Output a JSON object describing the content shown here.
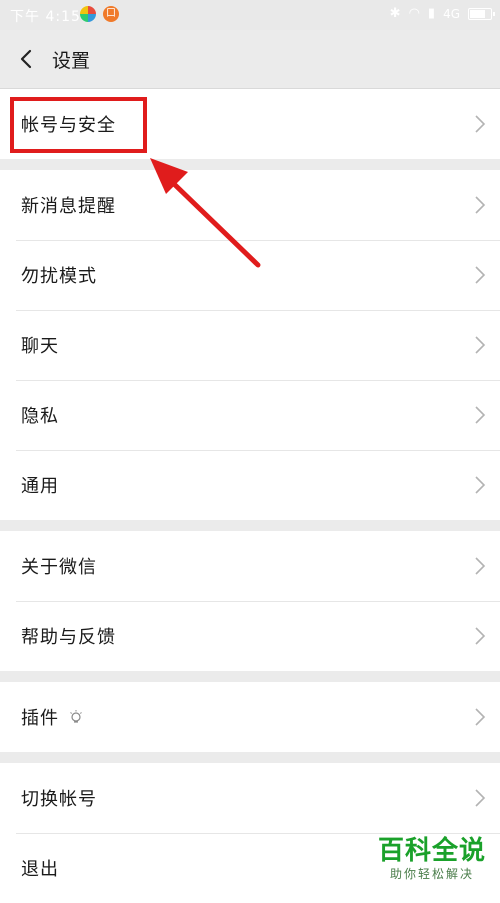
{
  "status_bar": {
    "time": "下午 4:15",
    "app2_glyph": "口",
    "network": "4G"
  },
  "header": {
    "title": "设置"
  },
  "groups": [
    {
      "items": [
        {
          "label": "帐号与安全"
        }
      ]
    },
    {
      "items": [
        {
          "label": "新消息提醒"
        },
        {
          "label": "勿扰模式"
        },
        {
          "label": "聊天"
        },
        {
          "label": "隐私"
        },
        {
          "label": "通用"
        }
      ]
    },
    {
      "items": [
        {
          "label": "关于微信"
        },
        {
          "label": "帮助与反馈"
        }
      ]
    },
    {
      "items": [
        {
          "label": "插件"
        }
      ]
    },
    {
      "items": [
        {
          "label": "切换帐号"
        },
        {
          "label": "退出"
        }
      ]
    }
  ],
  "watermark": {
    "title": "百科全说",
    "subtitle": "助你轻松解决"
  },
  "colors": {
    "annotation": "#e01c1c",
    "watermark": "#1aa12a"
  }
}
